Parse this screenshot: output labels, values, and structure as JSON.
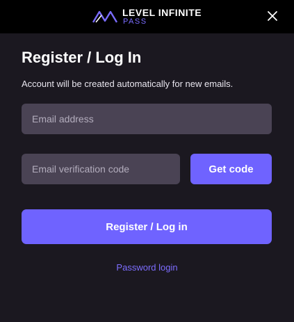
{
  "header": {
    "logo_line1": "LEVEL INFINITE",
    "logo_line2": "PASS",
    "logo_icon": "level-infinite-logo-icon",
    "close_icon": "close-icon"
  },
  "form": {
    "title": "Register / Log In",
    "subtitle": "Account will be created automatically for new emails.",
    "email_placeholder": "Email address",
    "email_value": "",
    "code_placeholder": "Email verification code",
    "code_value": "",
    "get_code_label": "Get code",
    "register_label": "Register / Log in",
    "password_login_label": "Password login"
  },
  "colors": {
    "accent": "#6f63ff",
    "background": "#1b1820",
    "header": "#000000",
    "input": "#4a4354",
    "link": "#7d6dff"
  }
}
